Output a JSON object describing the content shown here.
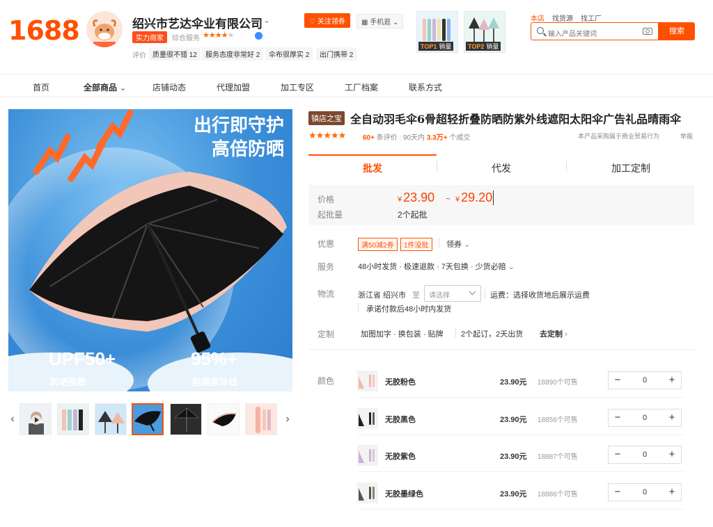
{
  "header": {
    "logo": "1688",
    "shop_name": "绍兴市艺达伞业有限公司",
    "badge": "实力商家",
    "rating_label": "综合服务",
    "stars": "★★★★",
    "eval_label": "评价",
    "eval_chips": [
      "质量很不错 12",
      "服务态度非常好 2",
      "伞布很厚实 2",
      "出门携带 2"
    ],
    "follow": "关注领券",
    "mobile": "手机逛",
    "rank": [
      {
        "num": "TOP1",
        "label": "销量"
      },
      {
        "num": "TOP2",
        "label": "销量"
      }
    ],
    "search_tabs": [
      "本店",
      "找货源",
      "找工厂"
    ],
    "search_placeholder": "输入产品关键词",
    "search_button": "搜索"
  },
  "nav": [
    "首页",
    "全部商品",
    "店铺动态",
    "代理加盟",
    "加工专区",
    "工厂档案",
    "联系方式"
  ],
  "hero": {
    "line1": "出行即守护",
    "line2": "高倍防晒",
    "stat_left": "UPF50+",
    "stat_right": "95%+",
    "sub_left": "防晒指数",
    "sub_right": "阻隔紫外线"
  },
  "product": {
    "badge": "镇店之宝",
    "title": "全自动羽毛伞6骨超轻折叠防晒防紫外线遮阳太阳伞广告礼品晴雨伞",
    "stars": "★★★★★",
    "reviews": "60+",
    "reviews_label": "条评价",
    "sold_prefix": "90天内",
    "sold": "3.3万+",
    "sold_label": "个成交",
    "purchase_note": "本产品采购属于商业贸易行为",
    "report": "举报"
  },
  "tabs": [
    "批发",
    "代发",
    "加工定制"
  ],
  "price": {
    "label": "价格",
    "currency": "¥",
    "min": "23.90",
    "sep": "~",
    "max": "29.20",
    "moq_label": "起批量",
    "moq": "2个起批"
  },
  "promo": {
    "label": "优惠",
    "coupons": [
      "满50减2券",
      "1件没批"
    ],
    "get": "领券"
  },
  "service": {
    "label": "服务",
    "text": "48小时发货 · 极速退款 · 7天包换 · 少货必赔"
  },
  "logistics": {
    "label": "物流",
    "origin": "浙江省 绍兴市",
    "to": "至",
    "select_placeholder": "请选择",
    "fee": "运费：选择收货地后展示运费",
    "promise": "承诺付款后48小时内发货"
  },
  "custom": {
    "label": "定制",
    "text": "加图加字 · 换包装 · 贴牌",
    "terms": "2个起订，2天出货",
    "link": "去定制"
  },
  "variants": {
    "label": "颜色",
    "items": [
      {
        "name": "无胶粉色",
        "price": "23.90元",
        "stock": "18890个可售",
        "qty": "0",
        "color": "#f4b9ad"
      },
      {
        "name": "无胶黑色",
        "price": "23.90元",
        "stock": "18856个可售",
        "qty": "0",
        "color": "#222222"
      },
      {
        "name": "无胶紫色",
        "price": "23.90元",
        "stock": "18887个可售",
        "qty": "0",
        "color": "#c8b3d6"
      },
      {
        "name": "无胶墨绿色",
        "price": "23.90元",
        "stock": "18886个可售",
        "qty": "0",
        "color": "#4e5a46"
      }
    ]
  },
  "colors": {
    "accent": "#ff5000",
    "price": "#ff3d00",
    "hero_blue": "#3b8fd9"
  }
}
